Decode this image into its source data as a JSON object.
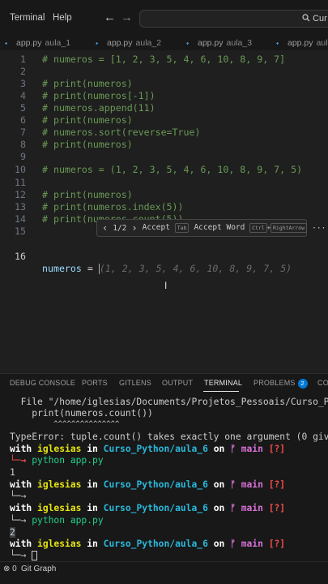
{
  "menu": [
    "Terminal",
    "Help"
  ],
  "nav": {
    "back": "←",
    "forward": "→"
  },
  "search": {
    "text": "Cur"
  },
  "tabs": [
    {
      "file": "app.py",
      "desc": "aula_1"
    },
    {
      "file": "app.py",
      "desc": "aula_2"
    },
    {
      "file": "app.py",
      "desc": "aula_3"
    },
    {
      "file": "app.py",
      "desc": "aula_"
    }
  ],
  "editor": {
    "lines": [
      {
        "n": "1",
        "text": "# numeros = [1, 2, 3, 5, 4, 6, 10, 8, 9, 7]"
      },
      {
        "n": "2",
        "text": ""
      },
      {
        "n": "3",
        "text": "# print(numeros)"
      },
      {
        "n": "4",
        "text": "# print(numeros[-1])"
      },
      {
        "n": "5",
        "text": "# numeros.append(11)"
      },
      {
        "n": "6",
        "text": "# print(numeros)"
      },
      {
        "n": "7",
        "text": "# numeros.sort(reverse=True)"
      },
      {
        "n": "8",
        "text": "# print(numeros)"
      },
      {
        "n": "9",
        "text": ""
      },
      {
        "n": "10",
        "text": "# numeros = (1, 2, 3, 5, 4, 6, 10, 8, 9, 7, 5)"
      },
      {
        "n": "11",
        "text": ""
      },
      {
        "n": "12",
        "text": "# print(numeros)"
      },
      {
        "n": "13",
        "text": "# print(numeros.index(5))"
      },
      {
        "n": "14",
        "text": "# print(numeros.count(5))"
      },
      {
        "n": "15",
        "text": ""
      }
    ],
    "active_line": {
      "n": "16",
      "var": "numeros",
      "op": " = ",
      "ghost": "(1, 2, 3, 5, 4, 6, 10, 8, 9, 7, 5)"
    }
  },
  "suggest": {
    "prev": "‹",
    "count": "1/2",
    "next": "›",
    "accept": "Accept",
    "accept_key": "Tab",
    "accept_word": "Accept Word",
    "word_key1": "Ctrl",
    "plus": "+",
    "word_key2": "RightArrow",
    "more": "···"
  },
  "panel": {
    "tabs": [
      "DEBUG CONSOLE",
      "PORTS",
      "GITLENS",
      "OUTPUT",
      "TERMINAL",
      "PROBLEMS",
      "CO"
    ],
    "problems_count": "2",
    "active_tab": "TERMINAL"
  },
  "terminal": {
    "error_file": "  File \"/home/iglesias/Documents/Projetos_Pessoais/Curso_Py",
    "error_code": "    print(numeros.count())",
    "error_carets": "          ^^^^^^^^^^^^^^^",
    "error_msg": "TypeError: tuple.count() takes exactly one argument (0 give",
    "prompt": {
      "with": "with ",
      "user": "iglesias",
      "in": " in ",
      "path": "Curso_Python/aula_6",
      "on": " on ",
      "branch_icon": "ᚠ",
      "branch": " main ",
      "status": "[?]",
      "arrow": "└─→",
      "arrow_plain": "└─→"
    },
    "cmd1": "python app.py",
    "out1": "1",
    "cmd2": "python app.py",
    "out2": "2"
  },
  "status": {
    "errors": "⊗ 0",
    "git": "Git Graph"
  }
}
